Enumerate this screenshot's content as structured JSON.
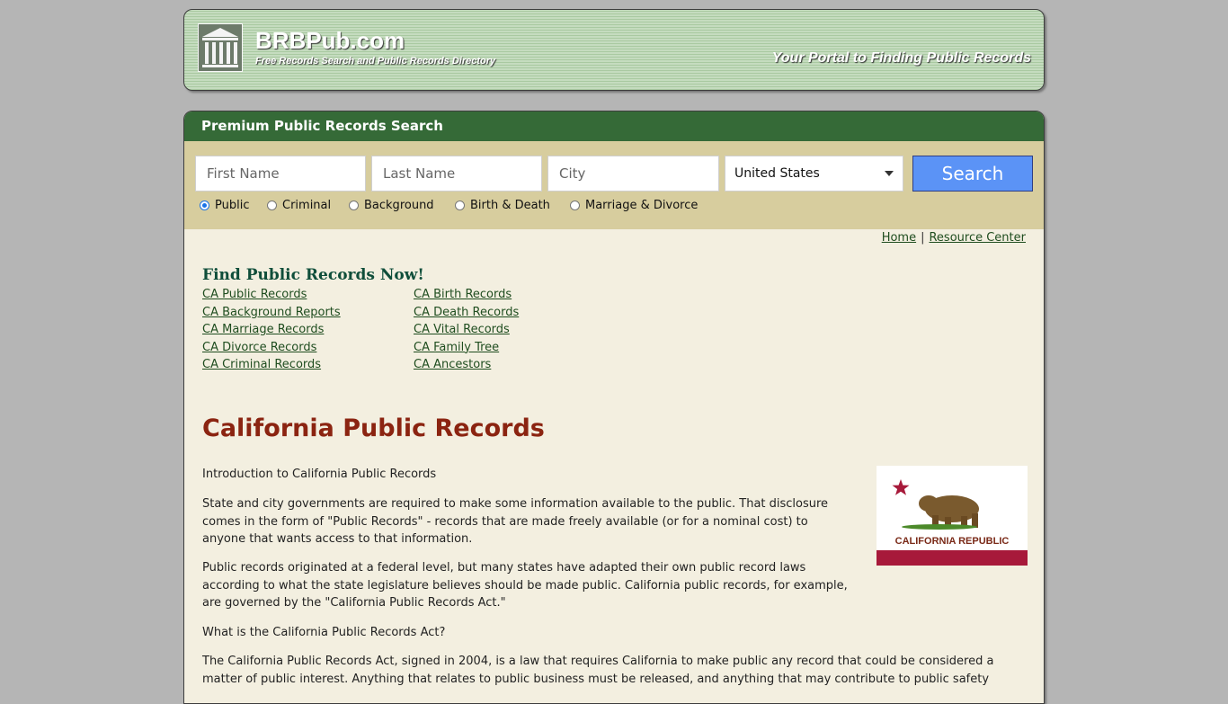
{
  "header": {
    "site_name": "BRBPub.com",
    "tagline": "Free Records Search and Public Records Directory",
    "portal_text": "Your Portal to Finding Public Records",
    "logo_icon": "building-columns-icon"
  },
  "search": {
    "title": "Premium Public Records Search",
    "first_name_placeholder": "First Name",
    "last_name_placeholder": "Last Name",
    "city_placeholder": "City",
    "country_selected": "United States",
    "button_label": "Search",
    "record_types": [
      "Public",
      "Criminal",
      "Background",
      "Birth & Death",
      "Marriage & Divorce"
    ],
    "selected_type": "Public"
  },
  "nav": {
    "home": "Home",
    "separator": "|",
    "resource_center": "Resource Center"
  },
  "find": {
    "title": "Find Public Records Now!",
    "col1": [
      "CA Public Records",
      "CA Background Reports",
      "CA Marriage Records",
      "CA Divorce Records",
      "CA Criminal Records"
    ],
    "col2": [
      "CA Birth Records",
      "CA Death Records",
      "CA Vital Records",
      "CA Family Tree",
      "CA Ancestors"
    ]
  },
  "article": {
    "title": "California Public Records",
    "intro_heading": "Introduction to California Public Records",
    "p1_lines": [
      "State and city governments are required to make some information available to the public. That disclosure",
      "comes in the form of \"Public Records\" - records that are made freely available (or for a nominal cost) to",
      "anyone that wants access to that information."
    ],
    "p2_lines": [
      "Public records originated at a federal level, but many states have adapted their own public record laws",
      "according to what the state legislature believes should be made public. California public records, for example,",
      "are governed by the \"California Public Records Act.\""
    ],
    "question": "What is the California Public Records Act?",
    "p3_lines": [
      "The California Public Records Act, signed in 2004, is a law that requires California to make public any record that could be considered a",
      "matter of public interest. Anything that relates to public business must be released, and anything that may contribute to public safety"
    ],
    "flag_text": "CALIFORNIA REPUBLIC"
  },
  "colors": {
    "green_bar": "#356a37",
    "search_bg": "#d7cd9e",
    "title_red": "#8b2411",
    "button_blue": "#5b93f6",
    "flag_red": "#a7193a"
  }
}
